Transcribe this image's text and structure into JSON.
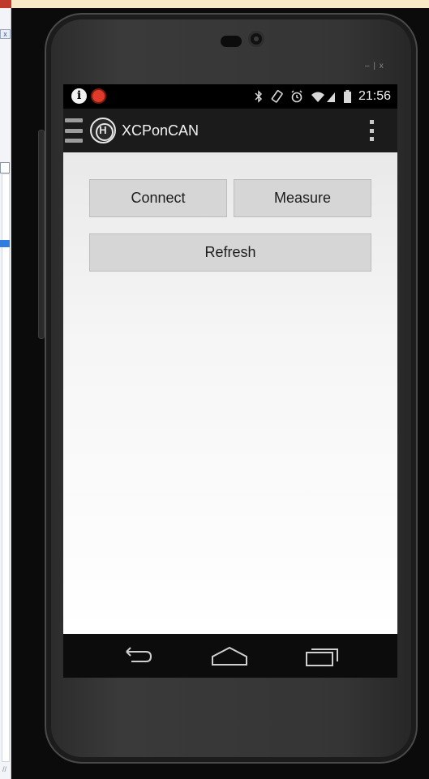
{
  "host_window": {
    "close_glyph": "x",
    "grip_glyph": "//"
  },
  "emulator": {
    "controls": "– | x"
  },
  "status_bar": {
    "info_glyph": "i",
    "time": "21:56",
    "icons": [
      "bluetooth-icon",
      "rotate-icon",
      "alarm-icon",
      "wifi-icon",
      "signal-icon",
      "battery-icon"
    ]
  },
  "action_bar": {
    "title": "XCPonCAN",
    "logo_glyph": "H"
  },
  "main": {
    "connect_label": "Connect",
    "measure_label": "Measure",
    "refresh_label": "Refresh"
  },
  "nav_bar": {
    "icons": [
      "back-icon",
      "home-icon",
      "recent-apps-icon"
    ]
  },
  "colors": {
    "button_bg": "#d6d6d6",
    "action_bar_bg": "#1b1b1b",
    "app_icon_red": "#e03b2a"
  }
}
